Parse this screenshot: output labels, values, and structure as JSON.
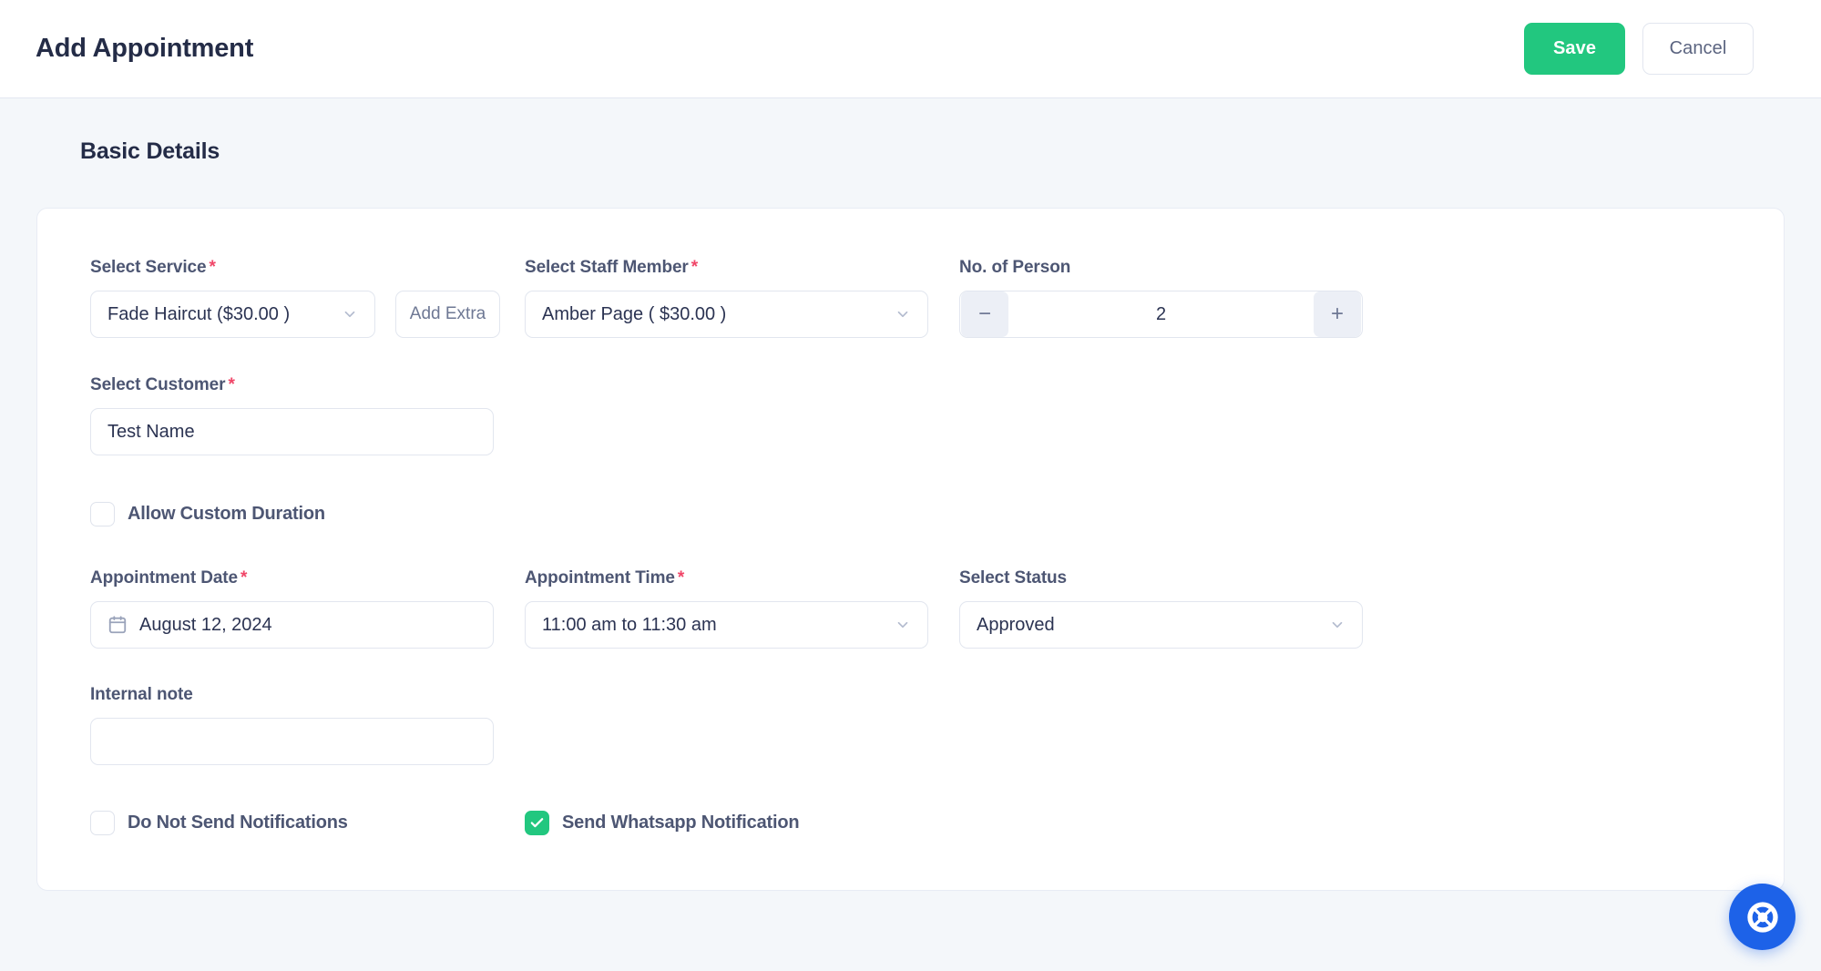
{
  "header": {
    "title": "Add Appointment",
    "save_label": "Save",
    "cancel_label": "Cancel",
    "save_color": "#22c77f"
  },
  "section": {
    "title": "Basic Details"
  },
  "form": {
    "service": {
      "label": "Select Service",
      "required": "*",
      "value": "Fade Haircut ($30.00 )",
      "add_extra_label": "Add Extra"
    },
    "staff": {
      "label": "Select Staff Member",
      "required": "*",
      "value": "Amber Page ( $30.00 )"
    },
    "persons": {
      "label": "No. of Person",
      "value": "2",
      "decrement_label": "−",
      "increment_label": "+"
    },
    "customer": {
      "label": "Select Customer",
      "required": "*",
      "value": "Test Name"
    },
    "custom_duration": {
      "label": "Allow Custom Duration",
      "checked": false
    },
    "date": {
      "label": "Appointment Date",
      "required": "*",
      "value": "August 12, 2024"
    },
    "time": {
      "label": "Appointment Time",
      "required": "*",
      "value": "11:00 am to 11:30 am"
    },
    "status": {
      "label": "Select Status",
      "value": "Approved"
    },
    "internal_note": {
      "label": "Internal note",
      "value": "",
      "placeholder": ""
    },
    "do_not_send": {
      "label": "Do Not Send Notifications",
      "checked": false
    },
    "whatsapp": {
      "label": "Send Whatsapp Notification",
      "checked": true
    }
  },
  "support": {
    "icon": "life-ring-icon",
    "color": "#1d62e8"
  }
}
